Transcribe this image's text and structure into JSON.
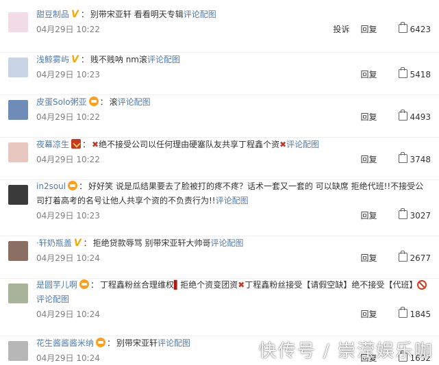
{
  "top_fragment": "",
  "comments": [
    {
      "user": "甜豆制品",
      "user_color": "#4f7db3",
      "badge": "v",
      "segments": [
        {
          "t": "text",
          "v": "别带宋亚轩 看看明天专辑"
        },
        {
          "t": "link",
          "v": "评论配图"
        }
      ],
      "time": "04月29日 10:22",
      "report": "投诉",
      "reply": "回复",
      "likes": "6423",
      "avatar_color": "#f1dce6"
    },
    {
      "user": "浅鲸雾屿",
      "user_color": "#4f7db3",
      "badge": "v",
      "segments": [
        {
          "t": "text",
          "v": "贱不贱呐 nm滚"
        },
        {
          "t": "link",
          "v": "评论配图"
        }
      ],
      "time": "04月29日 10:23",
      "reply": "回复",
      "likes": "5418",
      "avatar_color": "#c8d4e3"
    },
    {
      "user": "皮蛋Solo粥亚",
      "user_color": "#4f7db3",
      "badge": "crown",
      "segments": [
        {
          "t": "text",
          "v": "滚"
        },
        {
          "t": "link",
          "v": "评论配图"
        }
      ],
      "time": "04月29日 10:22",
      "reply": "回复",
      "likes": "4493",
      "avatar_color": "#6f8bb8"
    },
    {
      "user": "夜幕凉生",
      "user_color": "#4f7db3",
      "badge": "box",
      "segments": [
        {
          "t": "x",
          "v": "✖"
        },
        {
          "t": "text",
          "v": "绝不接受公司以任何理由硬塞队友共享丁程鑫个资"
        },
        {
          "t": "x",
          "v": "✖"
        },
        {
          "t": "link",
          "v": "评论配图"
        }
      ],
      "time": "04月29日 10:22",
      "reply": "回复",
      "likes": "3748",
      "avatar_color": "#e7c7c0"
    },
    {
      "user": "in2soul",
      "user_color": "#4f7db3",
      "badge": "crown",
      "segments": [
        {
          "t": "text",
          "v": "好好笑 说是瓜结果要去了脸被打的疼不疼？话术一套又一套的 可以缺席 拒绝代班!!不接受公司打着高考的名号让他人共享个资的不负责行为!!"
        },
        {
          "t": "link",
          "v": "评论配图"
        }
      ],
      "time": "04月29日 10:23",
      "reply": "回复",
      "likes": "3027",
      "avatar_color": "#3a3a3a"
    },
    {
      "user": "·轩奶瓶盖",
      "user_color": "#4f7db3",
      "badge": "v",
      "segments": [
        {
          "t": "text",
          "v": "拒绝贷款辱骂 别带宋亚轩大帅哥"
        },
        {
          "t": "link",
          "v": "评论配图"
        }
      ],
      "time": "04月29日 10:24",
      "reply": "回复",
      "likes": "2677",
      "avatar_color": "#8b6f63"
    },
    {
      "user": "是圆芋儿啊",
      "user_color": "#4f7db3",
      "badge": "crown",
      "segments": [
        {
          "t": "text",
          "v": "丁程鑫粉丝合理维权"
        },
        {
          "t": "bar",
          "v": "▌"
        },
        {
          "t": "text",
          "v": "拒绝个资变团资"
        },
        {
          "t": "x",
          "v": "✖"
        },
        {
          "t": "text",
          "v": "丁程鑫粉丝接受【请假空缺】绝不接受【代班】"
        },
        {
          "t": "no",
          "v": ""
        },
        {
          "t": "link",
          "v": "评论配图"
        }
      ],
      "time": "04月29日 10:24",
      "reply": "回复",
      "likes": "1845",
      "avatar_color": "#a8b39a"
    },
    {
      "user": "花生酱酱酱米纳",
      "user_color": "#4f7db3",
      "badge": "crown",
      "segments": [
        {
          "t": "text",
          "v": "别带宋亚轩"
        },
        {
          "t": "link",
          "v": "评论配图"
        }
      ],
      "time": "04月29日 10:24",
      "reply": "回复",
      "likes": "1632",
      "avatar_color": "#b7b7b7"
    }
  ],
  "watermark": "快传号 / 崇滢娱乐咖"
}
